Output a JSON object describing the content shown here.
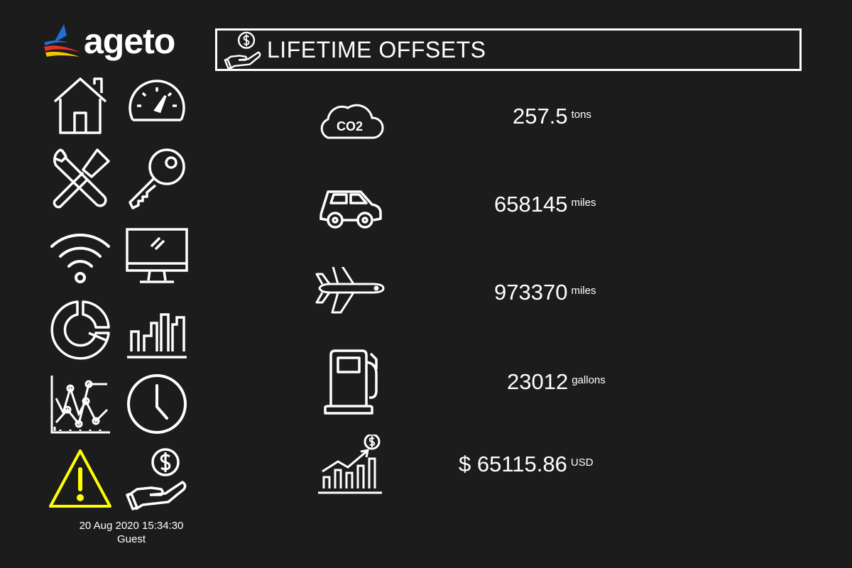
{
  "brand": {
    "name": "ageto",
    "colors": {
      "blue": "#1f6fd6",
      "red": "#e8302a",
      "yellow": "#f5c400"
    }
  },
  "nav": {
    "items": [
      {
        "icon": "home-icon"
      },
      {
        "icon": "speedometer-icon"
      },
      {
        "icon": "tools-icon"
      },
      {
        "icon": "key-icon"
      },
      {
        "icon": "wifi-icon"
      },
      {
        "icon": "monitor-icon"
      },
      {
        "icon": "pie-chart-icon"
      },
      {
        "icon": "bar-chart-icon"
      },
      {
        "icon": "line-chart-icon"
      },
      {
        "icon": "clock-icon"
      },
      {
        "icon": "warning-icon"
      },
      {
        "icon": "money-hand-icon"
      }
    ],
    "warning_color": "#ffff00"
  },
  "footer": {
    "datetime": "20 Aug 2020 15:34:30",
    "user": "Guest"
  },
  "header": {
    "icon": "money-hand-icon",
    "title": "LIFETIME OFFSETS"
  },
  "offsets": [
    {
      "icon": "co2-cloud-icon",
      "value": "257.5",
      "unit": "tons"
    },
    {
      "icon": "car-icon",
      "value": "658145",
      "unit": "miles"
    },
    {
      "icon": "airplane-icon",
      "value": "973370",
      "unit": "miles"
    },
    {
      "icon": "fuel-pump-icon",
      "value": "23012",
      "unit": "gallons"
    },
    {
      "icon": "growth-chart-icon",
      "value": "$ 65115.86",
      "unit": "USD"
    }
  ]
}
